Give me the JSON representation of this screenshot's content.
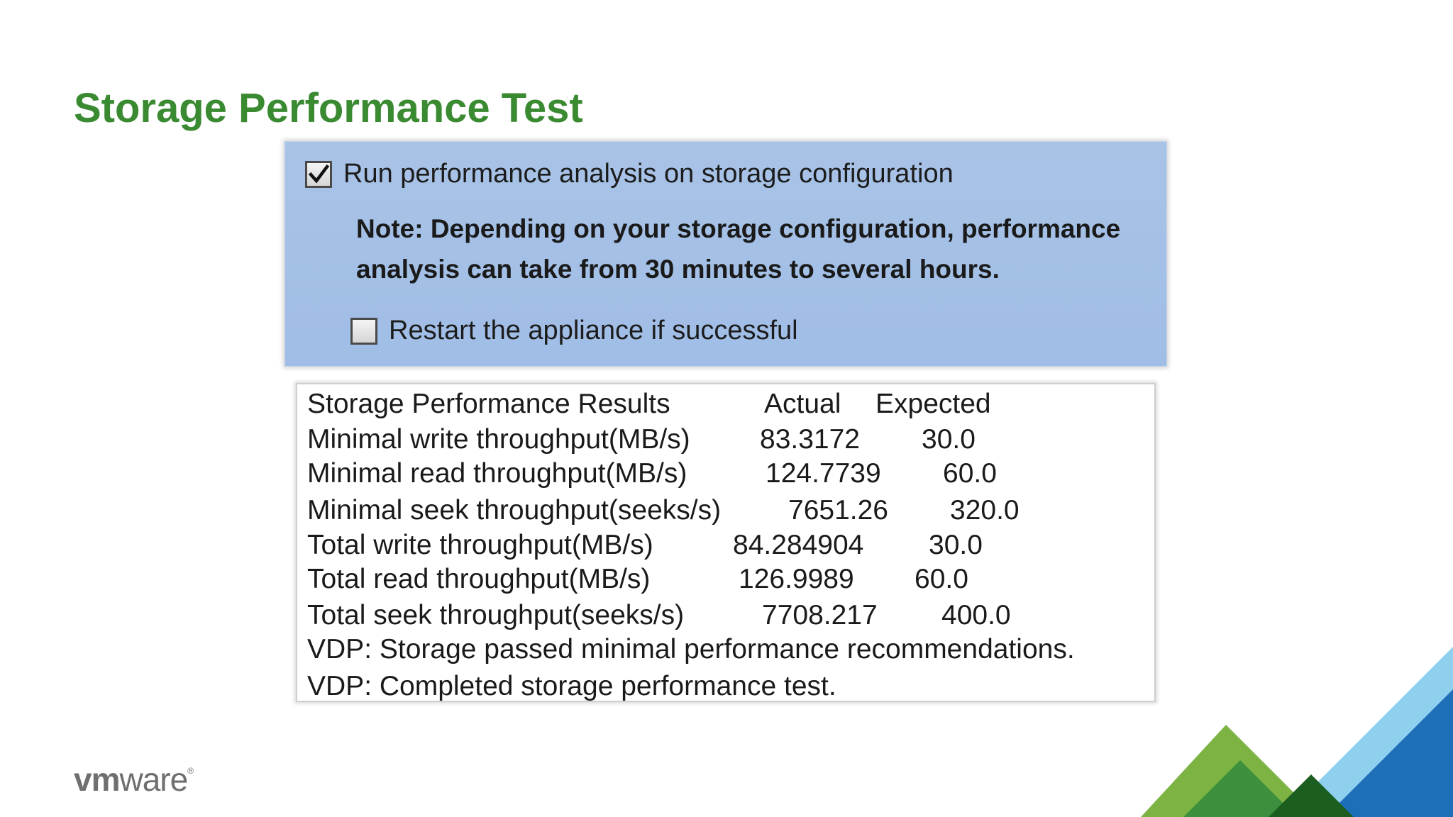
{
  "slide": {
    "title": "Storage Performance Test"
  },
  "options": {
    "run_analysis": {
      "label": "Run performance analysis on storage configuration",
      "checked": true
    },
    "note": "Note: Depending on your storage configuration, performance analysis can take from 30 minutes to several hours.",
    "restart": {
      "label": "Restart the appliance if successful",
      "checked": false
    }
  },
  "results": {
    "header": {
      "title": "Storage Performance Results",
      "actual": "Actual",
      "expected": "Expected"
    },
    "rows": [
      {
        "label": "Minimal write throughput(MB/s)",
        "actual": "83.3172",
        "expected": "30.0"
      },
      {
        "label": "Minimal read throughput(MB/s)",
        "actual": "124.7739",
        "expected": "60.0"
      },
      {
        "label": "Minimal seek throughput(seeks/s)",
        "actual": "7651.26",
        "expected": "320.0"
      },
      {
        "label": "Total write throughput(MB/s)",
        "actual": "84.284904",
        "expected": "30.0"
      },
      {
        "label": "Total read throughput(MB/s)",
        "actual": "126.9989",
        "expected": "60.0"
      },
      {
        "label": "Total seek throughput(seeks/s)",
        "actual": "7708.217",
        "expected": "400.0"
      }
    ],
    "messages": [
      "VDP: Storage passed minimal performance recommendations.",
      "VDP: Completed storage performance test."
    ]
  },
  "brand": {
    "logo_text_bold": "vm",
    "logo_text_light": "ware",
    "registered": "®"
  },
  "colors": {
    "title_green": "#3a8a32",
    "panel_blue": "#a3bfe6",
    "logo_gray": "#6f6f6f"
  }
}
